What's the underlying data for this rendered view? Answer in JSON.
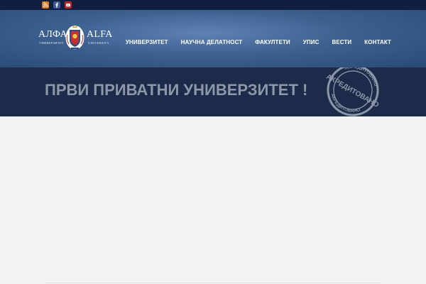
{
  "topbar": {
    "social": [
      {
        "icon": "rss-icon",
        "color": "#e07a1f"
      },
      {
        "icon": "facebook-icon",
        "color": "#3b5998"
      },
      {
        "icon": "youtube-icon",
        "color": "#cc2020"
      }
    ]
  },
  "logo": {
    "left_name": "АЛФА",
    "left_sub": "УНИВЕРЗИТЕТ",
    "right_name": "ALFA",
    "right_sub": "UNIVERSITY"
  },
  "nav": {
    "items": [
      {
        "label": "УНИВЕРЗИТЕТ"
      },
      {
        "label": "НАУЧНА ДЕЛАТНОСТ"
      },
      {
        "label": "ФАКУЛТЕТИ"
      },
      {
        "label": "УПИС"
      },
      {
        "label": "ВЕСТИ"
      },
      {
        "label": "КОНТАКТ"
      }
    ]
  },
  "banner": {
    "title": "ПРВИ ПРИВАТНИ УНИВЕРЗИТЕТ !",
    "stamp_main": "АКРЕДИТОВАНО",
    "stamp_ring_top": "АКРЕДИТОВАНО",
    "stamp_ring_bottom": "АКРЕДИТОВАНО"
  },
  "colors": {
    "topbar": "#0f1f3d",
    "header": "#3d618f",
    "banner": "#1b2b49",
    "banner_text": "#8c97a8",
    "page_bg": "#f3f3f3"
  }
}
